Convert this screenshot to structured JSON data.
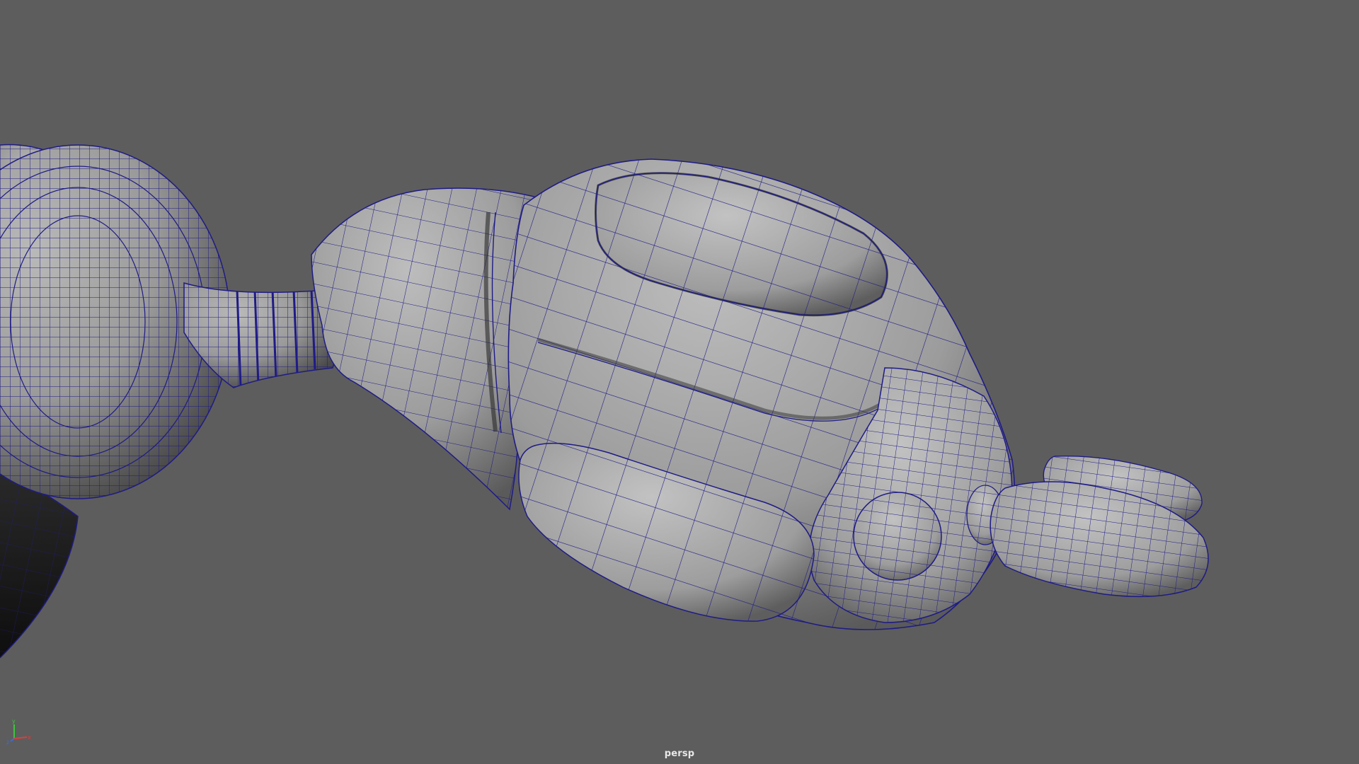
{
  "viewport": {
    "camera_name": "persp",
    "background_color": "#5d5d5d",
    "wireframe_color": "#1f1b86",
    "shaded_color": "#9a9a9a"
  },
  "axis_gizmo": {
    "x_label": "x",
    "y_label": "y",
    "z_label": "z",
    "x_color": "#e03c3c",
    "y_color": "#3cc43c",
    "z_color": "#3c6ce0"
  }
}
